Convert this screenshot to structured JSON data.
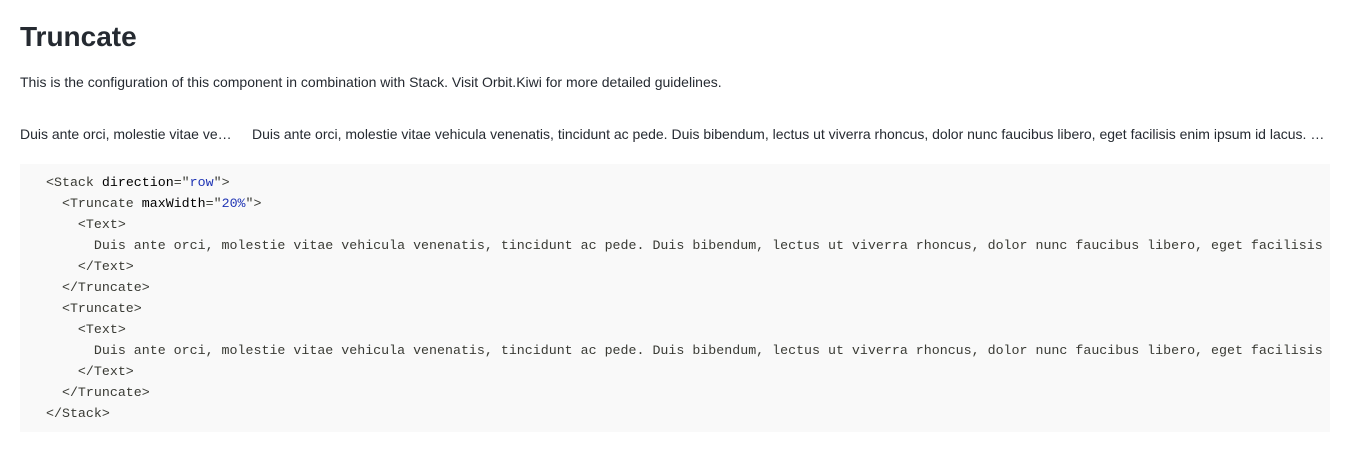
{
  "heading": {
    "title": "Truncate",
    "description": "This is the configuration of this component in combination with Stack. Visit Orbit.Kiwi for more detailed guidelines."
  },
  "demo": {
    "first_text": "Duis ante orci, molestie vitae vehicula venenatis, tincidunt ac pede. Duis bibendum, lectus ut viverra rhoncus, dolor nunc faucibus libero, eget facilisis enim ipsum id lacus. Nulla sit amet est.",
    "second_text": "Duis ante orci, molestie vitae vehicula venenatis, tincidunt ac pede. Duis bibendum, lectus ut viverra rhoncus, dolor nunc faucibus libero, eget facilisis enim ipsum id lacus. Nulla sit amet est."
  },
  "code": {
    "stack_open_tag": "<Stack",
    "stack_attr_name": "direction",
    "stack_attr_eq": "=\"",
    "stack_attr_value": "row",
    "stack_attr_close": "\">",
    "truncate1_open_tag": "<Truncate",
    "truncate1_attr_name": "maxWidth",
    "truncate1_attr_eq": "=\"",
    "truncate1_attr_value": "20%",
    "truncate1_attr_close": "\">",
    "text1_open": "<Text>",
    "text1_content": "Duis ante orci, molestie vitae vehicula venenatis, tincidunt ac pede. Duis bibendum, lectus ut viverra rhoncus, dolor nunc faucibus libero, eget facilisis",
    "text1_close": "</Text>",
    "truncate1_close": "</Truncate>",
    "truncate2_open": "<Truncate>",
    "text2_open": "<Text>",
    "text2_content": "Duis ante orci, molestie vitae vehicula venenatis, tincidunt ac pede. Duis bibendum, lectus ut viverra rhoncus, dolor nunc faucibus libero, eget facilisis",
    "text2_close": "</Text>",
    "truncate2_close": "</Truncate>",
    "stack_close": "</Stack>"
  },
  "colors": {
    "code_background": "#f9f9f9",
    "attr_value": "#1f34b4",
    "text": "#252a31"
  }
}
